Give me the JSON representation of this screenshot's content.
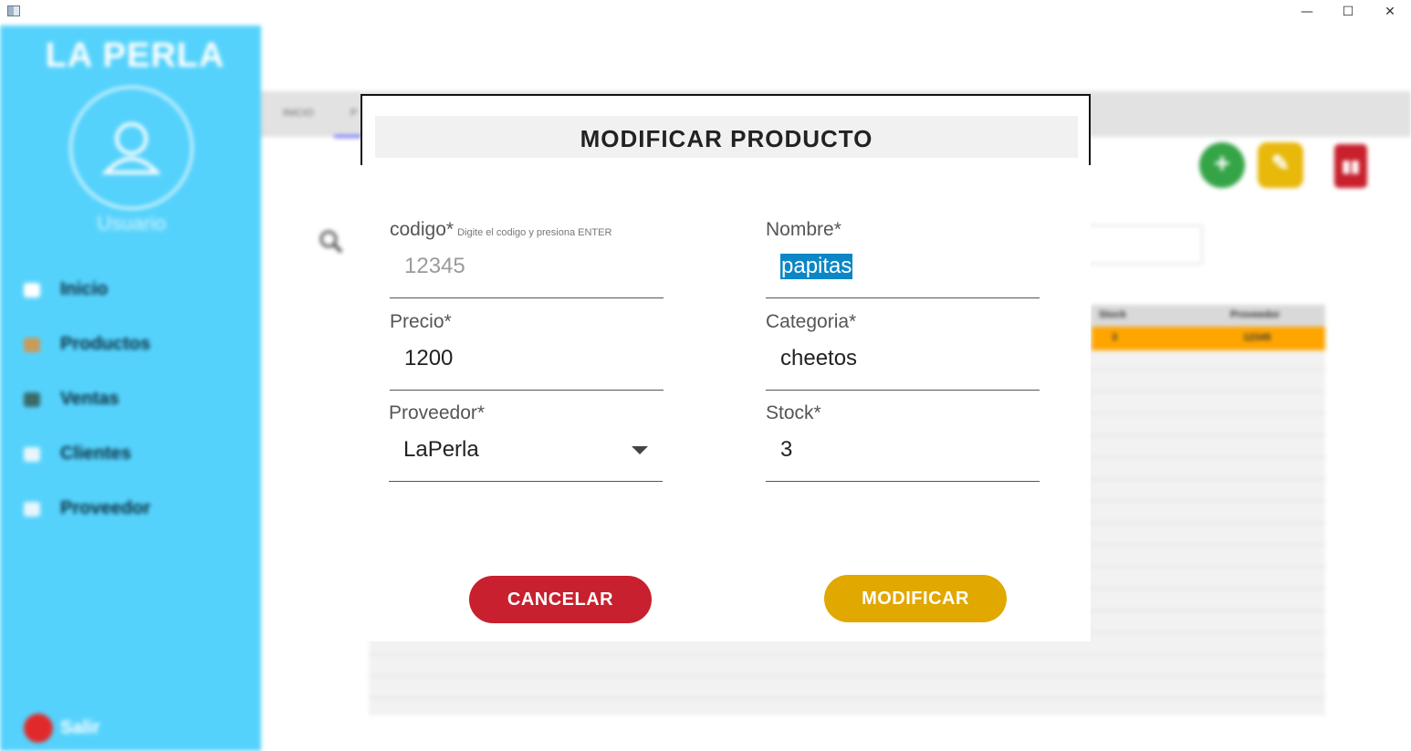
{
  "window": {
    "minimize_glyph": "—",
    "maximize_glyph": "☐",
    "close_glyph": "✕"
  },
  "sidebar": {
    "brand": "LA PERLA",
    "user_label": "Usuario",
    "items": [
      {
        "label": "Inicio",
        "icon": "home-icon",
        "color": "#ffffff"
      },
      {
        "label": "Productos",
        "icon": "box-icon",
        "color": "#c99a5a"
      },
      {
        "label": "Ventas",
        "icon": "chart-icon",
        "color": "#3a6a6a"
      },
      {
        "label": "Clientes",
        "icon": "users-icon",
        "color": "#e8f6fb"
      },
      {
        "label": "Proveedor",
        "icon": "truck-icon",
        "color": "#e8f6fb"
      }
    ],
    "exit_label": "Salir"
  },
  "background": {
    "tabs": [
      "INICIO",
      "P"
    ],
    "table_headers": [
      "Stock",
      "Proveedor"
    ],
    "selected_row": [
      "3",
      "12345"
    ]
  },
  "dialog": {
    "title": "MODIFICAR PRODUCTO",
    "fields": {
      "codigo": {
        "label": "codigo*",
        "hint": "Digite el codigo y presiona ENTER",
        "placeholder": "12345"
      },
      "nombre": {
        "label": "Nombre*",
        "value": "papitas"
      },
      "precio": {
        "label": "Precio*",
        "value": "1200"
      },
      "categoria": {
        "label": "Categoria*",
        "value": "cheetos"
      },
      "proveedor": {
        "label": "Proveedor*",
        "value": "LaPerla"
      },
      "stock": {
        "label": "Stock*",
        "value": "3"
      }
    },
    "cancel_label": "CANCELAR",
    "modify_label": "MODIFICAR"
  },
  "colors": {
    "sidebar": "#55d2fc",
    "cancel": "#c8202e",
    "modify": "#e1a800",
    "selection": "#0b86c6",
    "row_highlight": "#ffa500"
  }
}
